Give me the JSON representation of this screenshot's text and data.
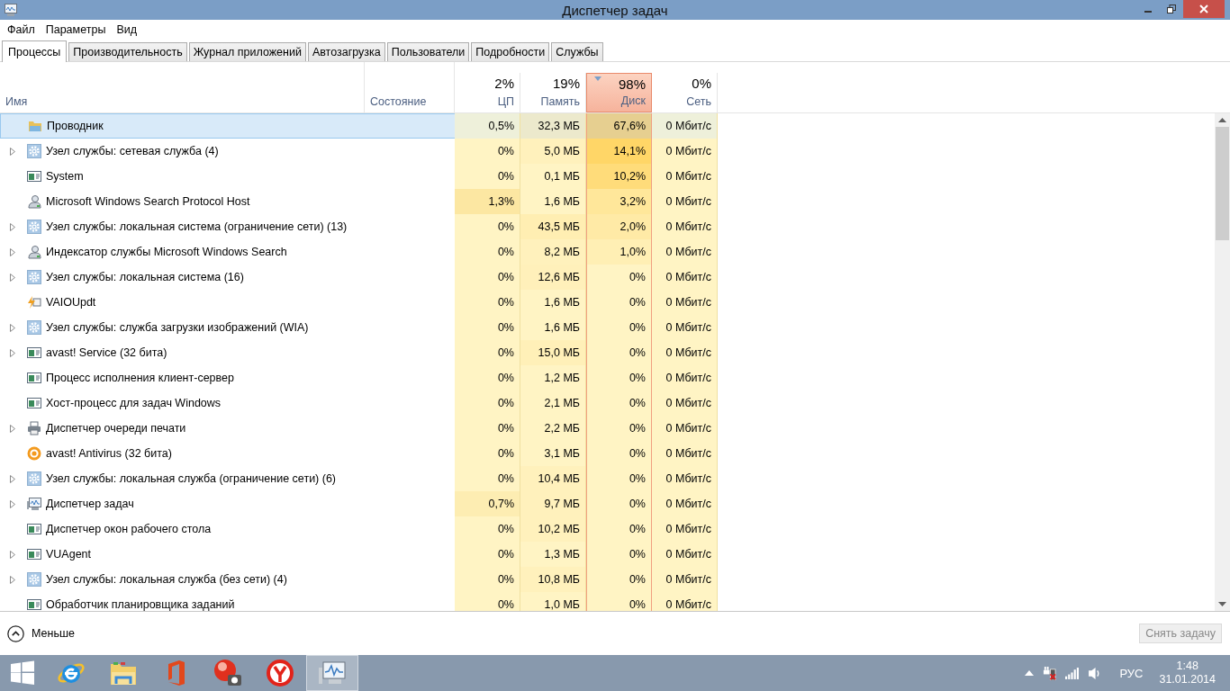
{
  "window": {
    "title": "Диспетчер задач"
  },
  "menu": [
    "Файл",
    "Параметры",
    "Вид"
  ],
  "tabs": [
    {
      "label": "Процессы",
      "selected": true
    },
    {
      "label": "Производительность",
      "selected": false
    },
    {
      "label": "Журнал приложений",
      "selected": false
    },
    {
      "label": "Автозагрузка",
      "selected": false
    },
    {
      "label": "Пользователи",
      "selected": false
    },
    {
      "label": "Подробности",
      "selected": false
    },
    {
      "label": "Службы",
      "selected": false
    }
  ],
  "columns": [
    {
      "label": "Имя",
      "kind": "text"
    },
    {
      "label": "Состояние",
      "kind": "text"
    },
    {
      "label": "ЦП",
      "percent": "2%",
      "kind": "metric",
      "sorted": false
    },
    {
      "label": "Память",
      "percent": "19%",
      "kind": "metric",
      "sorted": false
    },
    {
      "label": "Диск",
      "percent": "98%",
      "kind": "metric",
      "sorted": true
    },
    {
      "label": "Сеть",
      "percent": "0%",
      "kind": "metric",
      "sorted": false
    }
  ],
  "rows": [
    {
      "name": "Проводник",
      "kind": "folder",
      "expandable": false,
      "selected": true,
      "cells": [
        {
          "text": "0,5%",
          "color": "#eef0da"
        },
        {
          "text": "32,3 МБ",
          "color": "#ece9cc"
        },
        {
          "text": "67,6%",
          "color": "#e6cf90"
        },
        {
          "text": "0 Мбит/с",
          "color": "#eef0da"
        }
      ]
    },
    {
      "name": "Узел службы: сетевая служба (4)",
      "kind": "gear",
      "expandable": true,
      "selected": false,
      "cells": [
        {
          "text": "0%",
          "color": "#fff4c4"
        },
        {
          "text": "5,0 МБ",
          "color": "#fff1bc"
        },
        {
          "text": "14,1%",
          "color": "#ffd667"
        },
        {
          "text": "0 Мбит/с",
          "color": "#fff4c4"
        }
      ]
    },
    {
      "name": "System",
      "kind": "app",
      "expandable": false,
      "selected": false,
      "cells": [
        {
          "text": "0%",
          "color": "#fff4c4"
        },
        {
          "text": "0,1 МБ",
          "color": "#fff4c4"
        },
        {
          "text": "10,2%",
          "color": "#ffdc7a"
        },
        {
          "text": "0 Мбит/с",
          "color": "#fff4c4"
        }
      ]
    },
    {
      "name": "Microsoft Windows Search Protocol Host",
      "kind": "user",
      "expandable": false,
      "selected": false,
      "cells": [
        {
          "text": "1,3%",
          "color": "#fce7a2"
        },
        {
          "text": "1,6 МБ",
          "color": "#fff4c4"
        },
        {
          "text": "3,2%",
          "color": "#ffe79a"
        },
        {
          "text": "0 Мбит/с",
          "color": "#fff4c4"
        }
      ]
    },
    {
      "name": "Узел службы: локальная система (ограничение сети) (13)",
      "kind": "gear",
      "expandable": true,
      "selected": false,
      "cells": [
        {
          "text": "0%",
          "color": "#fff4c4"
        },
        {
          "text": "43,5 МБ",
          "color": "#ffeeb2"
        },
        {
          "text": "2,0%",
          "color": "#ffeaa6"
        },
        {
          "text": "0 Мбит/с",
          "color": "#fff4c4"
        }
      ]
    },
    {
      "name": "Индексатор службы Microsoft Windows Search",
      "kind": "user",
      "expandable": true,
      "selected": false,
      "cells": [
        {
          "text": "0%",
          "color": "#fff4c4"
        },
        {
          "text": "8,2 МБ",
          "color": "#fff1bc"
        },
        {
          "text": "1,0%",
          "color": "#ffefb4"
        },
        {
          "text": "0 Мбит/с",
          "color": "#fff4c4"
        }
      ]
    },
    {
      "name": "Узел службы: локальная система (16)",
      "kind": "gear",
      "expandable": true,
      "selected": false,
      "cells": [
        {
          "text": "0%",
          "color": "#fff4c4"
        },
        {
          "text": "12,6 МБ",
          "color": "#fff0ba"
        },
        {
          "text": "0%",
          "color": "#fff4c4"
        },
        {
          "text": "0 Мбит/с",
          "color": "#fff4c4"
        }
      ]
    },
    {
      "name": "VAIOUpdt",
      "kind": "bolt",
      "expandable": false,
      "selected": false,
      "cells": [
        {
          "text": "0%",
          "color": "#fff4c4"
        },
        {
          "text": "1,6 МБ",
          "color": "#fff4c4"
        },
        {
          "text": "0%",
          "color": "#fff4c4"
        },
        {
          "text": "0 Мбит/с",
          "color": "#fff4c4"
        }
      ]
    },
    {
      "name": "Узел службы: служба загрузки изображений (WIA)",
      "kind": "gear",
      "expandable": true,
      "selected": false,
      "cells": [
        {
          "text": "0%",
          "color": "#fff4c4"
        },
        {
          "text": "1,6 МБ",
          "color": "#fff4c4"
        },
        {
          "text": "0%",
          "color": "#fff4c4"
        },
        {
          "text": "0 Мбит/с",
          "color": "#fff4c4"
        }
      ]
    },
    {
      "name": "avast! Service (32 бита)",
      "kind": "app",
      "expandable": true,
      "selected": false,
      "cells": [
        {
          "text": "0%",
          "color": "#fff4c4"
        },
        {
          "text": "15,0 МБ",
          "color": "#fff0b8"
        },
        {
          "text": "0%",
          "color": "#fff4c4"
        },
        {
          "text": "0 Мбит/с",
          "color": "#fff4c4"
        }
      ]
    },
    {
      "name": "Процесс исполнения клиент-сервер",
      "kind": "app",
      "expandable": false,
      "selected": false,
      "cells": [
        {
          "text": "0%",
          "color": "#fff4c4"
        },
        {
          "text": "1,2 МБ",
          "color": "#fff4c4"
        },
        {
          "text": "0%",
          "color": "#fff4c4"
        },
        {
          "text": "0 Мбит/с",
          "color": "#fff4c4"
        }
      ]
    },
    {
      "name": "Хост-процесс для задач Windows",
      "kind": "app",
      "expandable": false,
      "selected": false,
      "cells": [
        {
          "text": "0%",
          "color": "#fff4c4"
        },
        {
          "text": "2,1 МБ",
          "color": "#fff4c4"
        },
        {
          "text": "0%",
          "color": "#fff4c4"
        },
        {
          "text": "0 Мбит/с",
          "color": "#fff4c4"
        }
      ]
    },
    {
      "name": "Диспетчер очереди печати",
      "kind": "printer",
      "expandable": true,
      "selected": false,
      "cells": [
        {
          "text": "0%",
          "color": "#fff4c4"
        },
        {
          "text": "2,2 МБ",
          "color": "#fff4c4"
        },
        {
          "text": "0%",
          "color": "#fff4c4"
        },
        {
          "text": "0 Мбит/с",
          "color": "#fff4c4"
        }
      ]
    },
    {
      "name": "avast! Antivirus (32 бита)",
      "kind": "ring",
      "expandable": false,
      "selected": false,
      "cells": [
        {
          "text": "0%",
          "color": "#fff4c4"
        },
        {
          "text": "3,1 МБ",
          "color": "#fff4c4"
        },
        {
          "text": "0%",
          "color": "#fff4c4"
        },
        {
          "text": "0 Мбит/с",
          "color": "#fff4c4"
        }
      ]
    },
    {
      "name": "Узел службы: локальная служба (ограничение сети) (6)",
      "kind": "gear",
      "expandable": true,
      "selected": false,
      "cells": [
        {
          "text": "0%",
          "color": "#fff4c4"
        },
        {
          "text": "10,4 МБ",
          "color": "#fff1bc"
        },
        {
          "text": "0%",
          "color": "#fff4c4"
        },
        {
          "text": "0 Мбит/с",
          "color": "#fff4c4"
        }
      ]
    },
    {
      "name": "Диспетчер задач",
      "kind": "monitor",
      "expandable": true,
      "selected": false,
      "cells": [
        {
          "text": "0,7%",
          "color": "#fdedb2"
        },
        {
          "text": "9,7 МБ",
          "color": "#fff1bc"
        },
        {
          "text": "0%",
          "color": "#fff4c4"
        },
        {
          "text": "0 Мбит/с",
          "color": "#fff4c4"
        }
      ]
    },
    {
      "name": "Диспетчер окон рабочего стола",
      "kind": "app",
      "expandable": false,
      "selected": false,
      "cells": [
        {
          "text": "0%",
          "color": "#fff4c4"
        },
        {
          "text": "10,2 МБ",
          "color": "#fff1bc"
        },
        {
          "text": "0%",
          "color": "#fff4c4"
        },
        {
          "text": "0 Мбит/с",
          "color": "#fff4c4"
        }
      ]
    },
    {
      "name": "VUAgent",
      "kind": "app",
      "expandable": true,
      "selected": false,
      "cells": [
        {
          "text": "0%",
          "color": "#fff4c4"
        },
        {
          "text": "1,3 МБ",
          "color": "#fff4c4"
        },
        {
          "text": "0%",
          "color": "#fff4c4"
        },
        {
          "text": "0 Мбит/с",
          "color": "#fff4c4"
        }
      ]
    },
    {
      "name": "Узел службы: локальная служба (без сети) (4)",
      "kind": "gear",
      "expandable": true,
      "selected": false,
      "cells": [
        {
          "text": "0%",
          "color": "#fff4c4"
        },
        {
          "text": "10,8 МБ",
          "color": "#fff1bc"
        },
        {
          "text": "0%",
          "color": "#fff4c4"
        },
        {
          "text": "0 Мбит/с",
          "color": "#fff4c4"
        }
      ]
    },
    {
      "name": "Обработчик планировщика заданий",
      "kind": "app",
      "expandable": false,
      "selected": false,
      "cells": [
        {
          "text": "0%",
          "color": "#fff4c4"
        },
        {
          "text": "1,0 МБ",
          "color": "#fff4c4"
        },
        {
          "text": "0%",
          "color": "#fff4c4"
        },
        {
          "text": "0 Мбит/с",
          "color": "#fff4c4"
        }
      ]
    }
  ],
  "footer": {
    "toggle": "Меньше",
    "end_task": {
      "label": "Снять задачу",
      "disabled": true
    }
  },
  "taskbar": {
    "apps": [
      {
        "kind": "ie",
        "selected": false
      },
      {
        "kind": "explorer",
        "selected": false
      },
      {
        "kind": "office",
        "selected": false
      },
      {
        "kind": "camera",
        "selected": false
      },
      {
        "kind": "browser",
        "selected": false
      },
      {
        "kind": "taskmgr",
        "selected": true
      }
    ],
    "language": "РУС",
    "time": "1:48",
    "date": "31.01.2014"
  }
}
